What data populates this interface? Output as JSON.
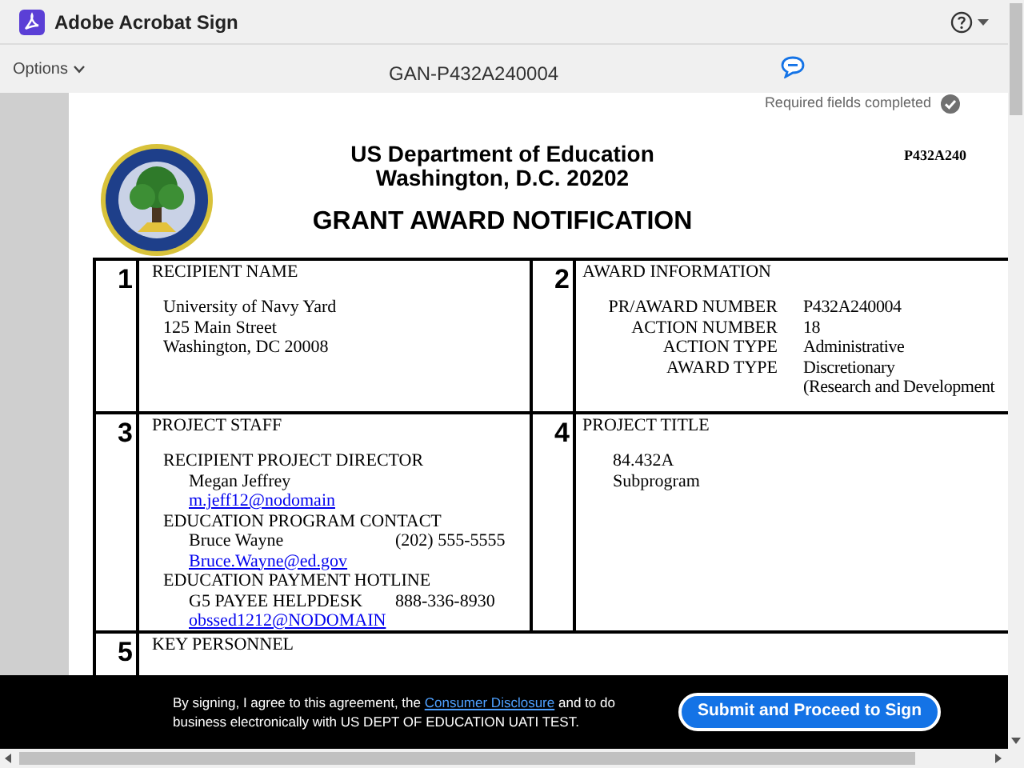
{
  "app": {
    "name": "Adobe Acrobat Sign"
  },
  "toolbar": {
    "options_label": "Options",
    "document_title": "GAN-P432A240004"
  },
  "status": {
    "text": "Required fields completed",
    "completed": true
  },
  "document": {
    "page_ref": "P432A240",
    "header_lines": [
      "US Department of Education",
      "Washington, D.C. 20202"
    ],
    "title": "GRANT AWARD NOTIFICATION",
    "section_1": {
      "number": "1",
      "heading": "RECIPIENT NAME",
      "lines": [
        "University of Navy Yard",
        "125 Main Street",
        "Washington, DC 20008"
      ]
    },
    "section_2": {
      "number": "2",
      "heading": "AWARD INFORMATION",
      "rows": [
        {
          "label": "PR/AWARD NUMBER",
          "value": "P432A240004"
        },
        {
          "label": "ACTION NUMBER",
          "value": "18"
        },
        {
          "label": "ACTION TYPE",
          "value": "Administrative"
        },
        {
          "label": "AWARD TYPE",
          "value": "Discretionary"
        },
        {
          "value": "(Research and Development"
        }
      ]
    },
    "section_3": {
      "number": "3",
      "heading": "PROJECT STAFF",
      "groups": [
        {
          "heading": "RECIPIENT PROJECT DIRECTOR",
          "entries": [
            {
              "kind": "text",
              "text": "Megan Jeffrey"
            },
            {
              "kind": "link",
              "text": "m.jeff12@nodomain"
            }
          ]
        },
        {
          "heading": "EDUCATION PROGRAM CONTACT",
          "entries": [
            {
              "kind": "text",
              "text": "Bruce Wayne",
              "phone": "(202) 555-5555"
            },
            {
              "kind": "link",
              "text": "Bruce.Wayne@ed.gov"
            }
          ]
        },
        {
          "heading": "EDUCATION PAYMENT HOTLINE",
          "entries": [
            {
              "kind": "text",
              "text": "G5 PAYEE HELPDESK",
              "phone": "888-336-8930"
            },
            {
              "kind": "link",
              "text": "obssed1212@NODOMAIN"
            }
          ]
        }
      ]
    },
    "section_4": {
      "number": "4",
      "heading": "PROJECT TITLE",
      "lines": [
        "84.432A",
        "Subprogram"
      ]
    },
    "section_5": {
      "number": "5",
      "heading": "KEY PERSONNEL"
    }
  },
  "footer": {
    "consent_before": "By signing, I agree to this agreement, the",
    "consent_link": "Consumer Disclosure",
    "consent_after": "and to do business electronically with US DEPT OF EDUCATION UATI TEST.",
    "submit_label": "Submit and Proceed to Sign"
  }
}
